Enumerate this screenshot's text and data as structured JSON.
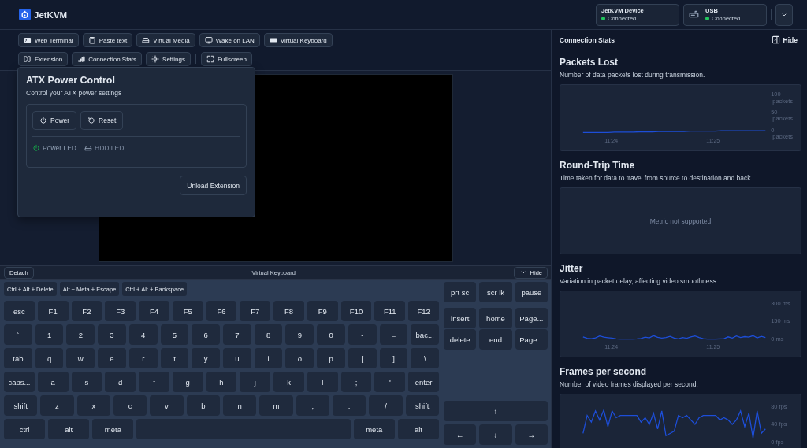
{
  "header": {
    "logo_text": "JetKVM",
    "statuses": [
      {
        "label": "JetKVM Device",
        "status": "Connected",
        "connected": true
      },
      {
        "label": "USB",
        "status": "Connected",
        "connected": true
      }
    ]
  },
  "toolbar": {
    "rows": [
      [
        "Web Terminal",
        "Paste text",
        "Virtual Media",
        "Wake on LAN",
        "Virtual Keyboard"
      ],
      [
        "Extension",
        "Connection Stats",
        "Settings",
        "Fullscreen"
      ]
    ]
  },
  "atx_popover": {
    "title": "ATX Power Control",
    "subtitle": "Control your ATX power settings",
    "buttons": [
      "Power",
      "Reset"
    ],
    "leds": [
      {
        "label": "Power LED",
        "on": true
      },
      {
        "label": "HDD LED",
        "on": false
      }
    ],
    "unload_button": "Unload Extension"
  },
  "keyboard": {
    "detach_button": "Detach",
    "title": "Virtual Keyboard",
    "hide_button": "Hide",
    "macros": [
      "Ctrl + Alt + Delete",
      "Alt + Meta + Escape",
      "Ctrl + Alt + Backspace"
    ],
    "rows": [
      {
        "keys": [
          "esc",
          "F1",
          "F2",
          "F3",
          "F4",
          "F5",
          "F6",
          "F7",
          "F8",
          "F9",
          "F10",
          "F11",
          "F12"
        ]
      },
      {
        "keys": [
          "`",
          "1",
          "2",
          "3",
          "4",
          "5",
          "6",
          "7",
          "8",
          "9",
          "0",
          "-",
          "=",
          "bac..."
        ]
      },
      {
        "keys": [
          "tab",
          "q",
          "w",
          "e",
          "r",
          "t",
          "y",
          "u",
          "i",
          "o",
          "p",
          "[",
          "]",
          "\\"
        ]
      },
      {
        "keys": [
          "caps...",
          "a",
          "s",
          "d",
          "f",
          "g",
          "h",
          "j",
          "k",
          "l",
          ";",
          "'",
          "enter"
        ]
      },
      {
        "keys": [
          "shift",
          "z",
          "x",
          "c",
          "v",
          "b",
          "n",
          "m",
          ",",
          ".",
          "/",
          "shift"
        ]
      }
    ],
    "bottom_row": [
      {
        "kind": "key",
        "label": "ctrl"
      },
      {
        "kind": "key",
        "label": "alt"
      },
      {
        "kind": "key",
        "label": "meta"
      },
      {
        "kind": "space"
      },
      {
        "kind": "key",
        "label": "meta"
      },
      {
        "kind": "key",
        "label": "alt"
      }
    ],
    "nav_keys": [
      [
        "prt sc",
        "scr lk",
        "pause"
      ],
      [
        "insert",
        "home",
        "Page..."
      ],
      [
        "delete",
        "end",
        "Page..."
      ]
    ],
    "arrow_keys": [
      [
        "↑"
      ],
      [
        "←",
        "↓",
        "→"
      ]
    ]
  },
  "stats_panel": {
    "title": "Connection Stats",
    "hide_button": "Hide",
    "sections": [
      {
        "kind": "chart",
        "title": "Packets Lost",
        "description": "Number of data packets lost during transmission.",
        "x_labels": [
          "11:24",
          "11:25"
        ],
        "chart_data": {
          "type": "line",
          "ylim": [
            0,
            100
          ],
          "yticks": [
            {
              "value": 100,
              "label": "100 packets"
            },
            {
              "value": 50,
              "label": "50 packets"
            },
            {
              "value": 0,
              "label": "0 packets"
            }
          ],
          "series": [
            {
              "color": "#1d4ed8",
              "values": [
                1,
                1,
                1,
                1,
                1,
                2,
                2,
                2,
                2,
                3,
                3,
                3,
                4,
                4,
                4,
                4,
                4,
                5,
                5,
                5,
                5,
                5,
                6,
                6,
                6,
                6,
                6,
                6,
                6,
                6
              ]
            }
          ]
        }
      },
      {
        "kind": "message",
        "title": "Round-Trip Time",
        "description": "Time taken for data to travel from source to destination and back",
        "message": "Metric not supported"
      },
      {
        "kind": "chart",
        "title": "Jitter",
        "description": "Variation in packet delay, affecting video smoothness.",
        "x_labels": [
          "11:24",
          "11:25"
        ],
        "chart_data": {
          "type": "line",
          "ylim": [
            0,
            300
          ],
          "yticks": [
            {
              "value": 300,
              "label": "300 ms"
            },
            {
              "value": 150,
              "label": "150 ms"
            },
            {
              "value": 0,
              "label": "0 ms"
            }
          ],
          "series": [
            {
              "color": "#1d4ed8",
              "values": [
                20,
                8,
                5,
                12,
                28,
                18,
                14,
                10,
                3,
                2,
                2,
                2,
                2,
                3,
                6,
                18,
                12,
                30,
                16,
                10,
                15,
                25,
                10,
                3,
                15,
                8,
                20,
                28,
                15,
                5,
                2,
                2,
                2,
                3,
                5,
                20,
                10,
                28,
                15,
                22,
                18,
                30,
                12,
                25,
                15
              ]
            }
          ]
        }
      },
      {
        "kind": "chart",
        "title": "Frames per second",
        "description": "Number of video frames displayed per second.",
        "chart_data": {
          "type": "line",
          "ylim": [
            0,
            80
          ],
          "yticks": [
            {
              "value": 80,
              "label": "80 fps"
            },
            {
              "value": 40,
              "label": "40 fps"
            },
            {
              "value": 0,
              "label": "0 fps"
            }
          ],
          "series": [
            {
              "color": "#1d4ed8",
              "values": [
                20,
                60,
                45,
                70,
                50,
                72,
                35,
                70,
                55,
                60,
                60,
                60,
                60,
                60,
                45,
                55,
                40,
                65,
                30,
                70,
                15,
                20,
                25,
                60,
                55,
                60,
                50,
                40,
                55,
                60,
                60,
                60,
                60,
                50,
                55,
                50,
                40,
                50,
                70,
                35,
                65,
                10,
                70,
                20,
                30
              ]
            }
          ]
        }
      }
    ]
  }
}
